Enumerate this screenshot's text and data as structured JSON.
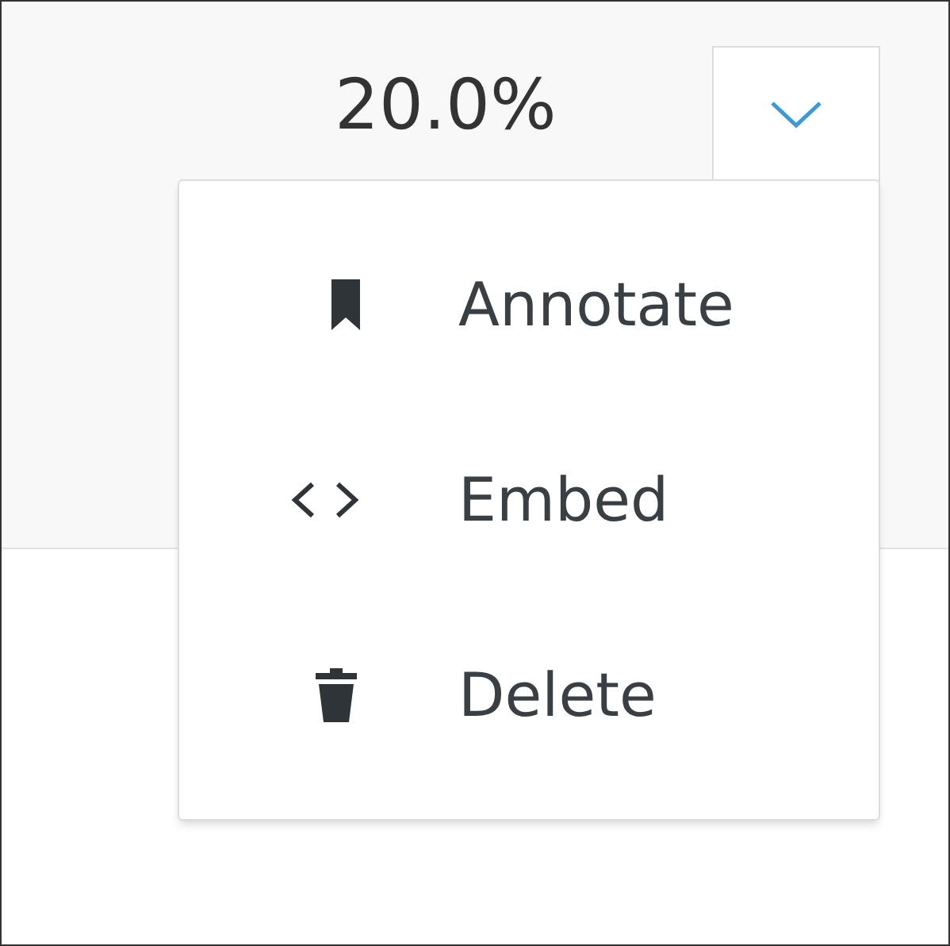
{
  "value": "20.0%",
  "dropdown": {
    "expanded": true
  },
  "menu": [
    {
      "kind": "annotate",
      "label": "Annotate"
    },
    {
      "kind": "embed",
      "label": "Embed"
    },
    {
      "kind": "delete",
      "label": "Delete"
    }
  ]
}
